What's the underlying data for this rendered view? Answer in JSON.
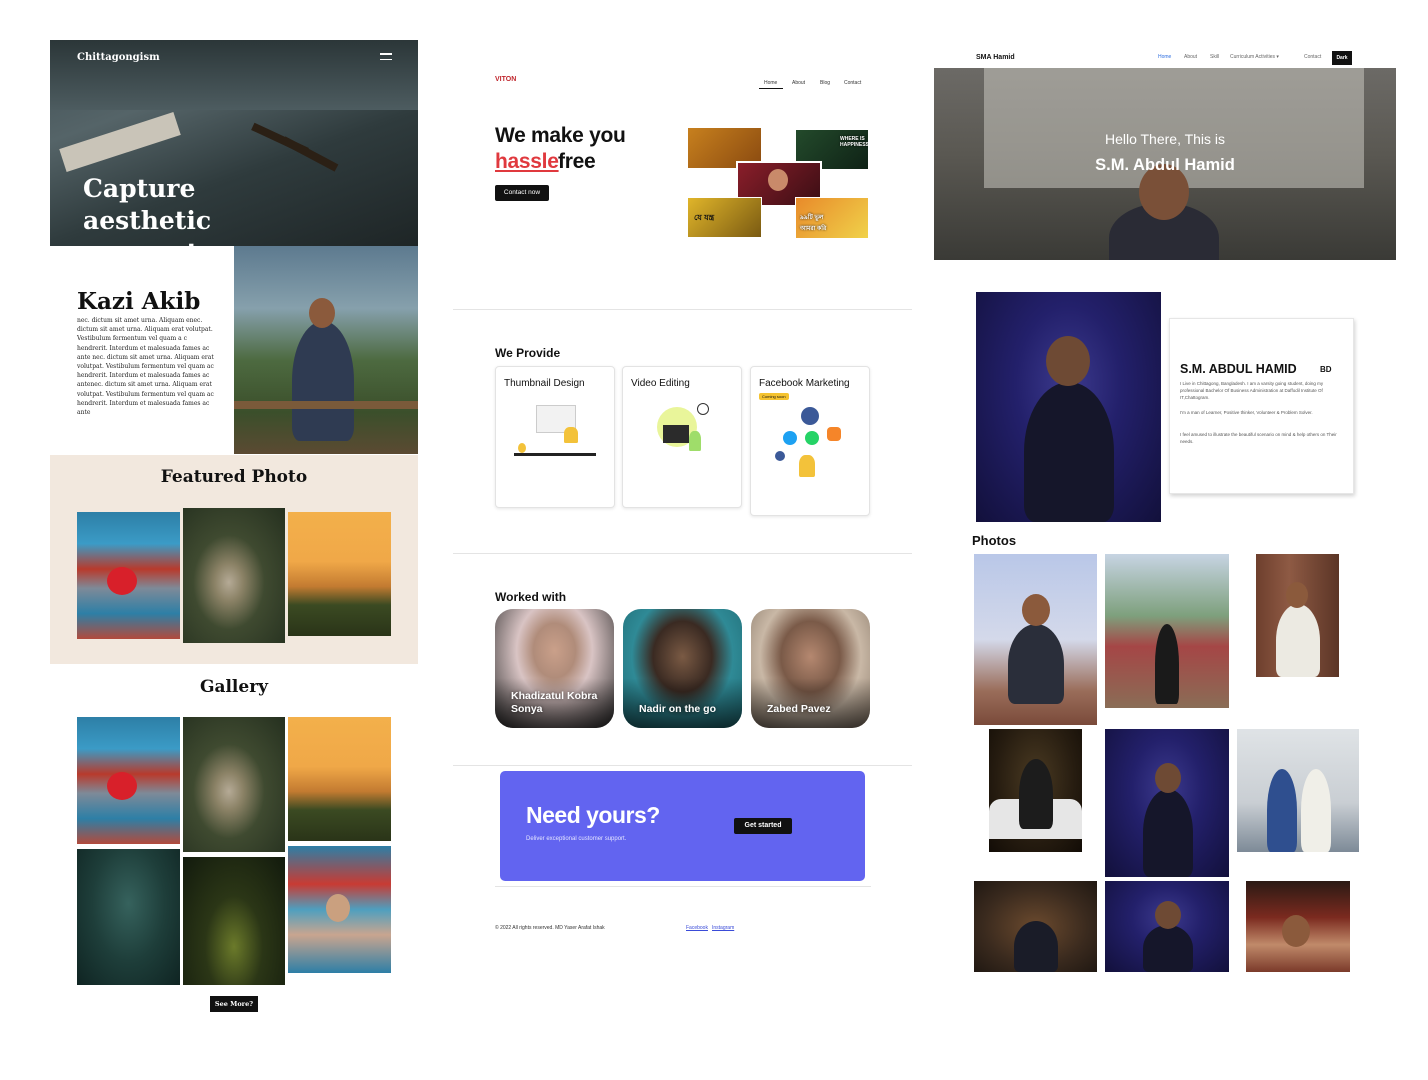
{
  "left_site": {
    "brand": "Chittagongism",
    "hero_title": "Capture aesthetic moments",
    "about": {
      "name": "Kazi Akib",
      "text": "nec. dictum sit amet urna. Aliquam enec. dictum sit amet urna. Aliquam erat volutpat. Vestibulum fermentum vel quam a c hendrerit. Interdum et malesuada fames ac ante nec. dictum sit amet urna. Aliquam erat volutpat. Vestibulum fermentum vel quam ac hendrerit. Interdum et malesuada fames ac antenec. dictum sit amet urna. Aliquam erat volutpat. Vestibulum fermentum vel quam ac hendrerit. Interdum et malesuada fames ac ante"
    },
    "featured_title": "Featured Photo",
    "gallery_title": "Gallery",
    "see_more_label": "See More?",
    "colors": {
      "featured_bg": "#f2e8de",
      "button_bg": "#111111"
    }
  },
  "middle_site": {
    "logo": "VITON",
    "nav": [
      "Home",
      "About",
      "Blog",
      "Contact"
    ],
    "headline_line1": "We make you",
    "headline_highlight": "hassle",
    "headline_tail": "free",
    "contact_button": "Contact now",
    "thumbnails": [
      {
        "text": ""
      },
      {
        "text": "WHERE IS HAPPINESS?"
      },
      {
        "text": ""
      },
      {
        "text": "যে যন্ত্র"
      },
      {
        "text": "৯৯টি ভুল আমরা করি"
      }
    ],
    "provide_title": "We Provide",
    "services": [
      {
        "title": "Thumbnail Design",
        "badge": ""
      },
      {
        "title": "Video Editing",
        "badge": ""
      },
      {
        "title": "Facebook Marketing",
        "badge": "Coming soon"
      }
    ],
    "worked_title": "Worked with",
    "workers": [
      {
        "name": "Khadizatul Kobra Sonya"
      },
      {
        "name": "Nadir on the go"
      },
      {
        "name": "Zabed Pavez"
      }
    ],
    "cta": {
      "title": "Need yours?",
      "subtitle": "Deliver exceptional customer support.",
      "button": "Get started"
    },
    "footer": {
      "copyright": "© 2022 All rights reserved. MD Yaser Arafat Ishak",
      "links": [
        "Facebook",
        "Instagram"
      ]
    },
    "colors": {
      "accent_red": "#e0393e",
      "cta_bg": "#6264f0"
    }
  },
  "right_site": {
    "brand": "SMA Hamid",
    "nav": [
      "Home",
      "About",
      "Skill",
      "Curriculum Activities ▾",
      "Contact"
    ],
    "dark_button": "Dark",
    "hero_greeting": "Hello There, This is",
    "hero_name": "S.M. Abdul Hamid",
    "card": {
      "name": "S.M. ABDUL HAMID",
      "suffix": "BD",
      "paragraphs": [
        "I Live in Chittagong, Bangladesh. I am a varsity going student, doing my professional Bachelor Of Business Administration at Daffodil Institute Of IT,Chattogram.",
        "I'm a man of Learner, Positive thinker, Volunteer & Problem Solver.",
        "I feel amused to illustrate the beautiful scenario on mind & help others on Their needs."
      ]
    },
    "photos_title": "Photos",
    "colors": {
      "nav_active": "#2f6fe0",
      "dark_bg": "#111111"
    }
  }
}
